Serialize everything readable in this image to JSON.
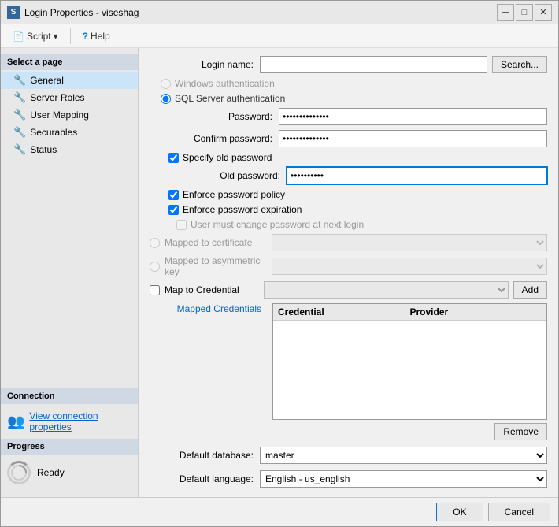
{
  "window": {
    "title": "Login Properties - viseshag",
    "icon_label": "S"
  },
  "toolbar": {
    "script_label": "Script",
    "help_label": "Help"
  },
  "sidebar": {
    "select_page_label": "Select a page",
    "items": [
      {
        "label": "General",
        "id": "general"
      },
      {
        "label": "Server Roles",
        "id": "server-roles"
      },
      {
        "label": "User Mapping",
        "id": "user-mapping"
      },
      {
        "label": "Securables",
        "id": "securables"
      },
      {
        "label": "Status",
        "id": "status"
      }
    ],
    "connection_label": "Connection",
    "connection_link": "View connection properties",
    "progress_label": "Progress",
    "progress_status": "Ready"
  },
  "form": {
    "login_name_label": "Login name:",
    "login_name_value": "",
    "search_button": "Search...",
    "windows_auth_label": "Windows authentication",
    "sql_auth_label": "SQL Server authentication",
    "password_label": "Password:",
    "password_value": "••••••••••••••",
    "confirm_password_label": "Confirm password:",
    "confirm_password_value": "••••••••••••••",
    "specify_old_label": "Specify old password",
    "old_password_label": "Old password:",
    "old_password_value": "••••••••••",
    "enforce_policy_label": "Enforce password policy",
    "enforce_expiration_label": "Enforce password expiration",
    "must_change_label": "User must change password at next login",
    "mapped_cert_label": "Mapped to certificate",
    "mapped_asym_label": "Mapped to asymmetric key",
    "map_credential_label": "Map to Credential",
    "add_button": "Add",
    "mapped_credentials_label": "Mapped Credentials",
    "credential_col": "Credential",
    "provider_col": "Provider",
    "remove_button": "Remove",
    "default_db_label": "Default database:",
    "default_db_value": "master",
    "default_lang_label": "Default language:",
    "default_lang_value": "English - us_english"
  },
  "footer": {
    "ok_label": "OK",
    "cancel_label": "Cancel"
  }
}
